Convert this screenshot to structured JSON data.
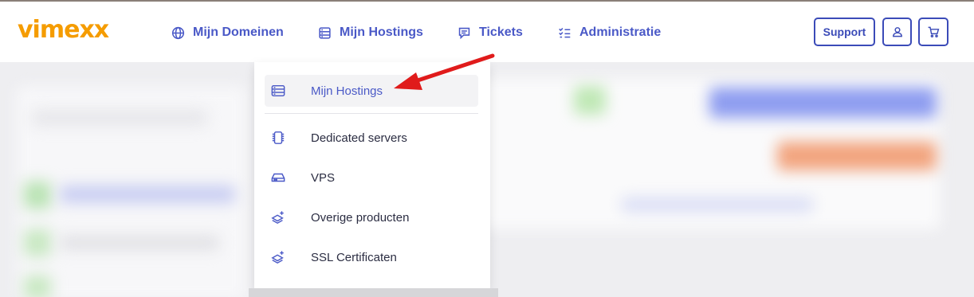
{
  "logo": "vimexx",
  "nav": [
    {
      "label": "Mijn Domeinen",
      "icon": "globe-icon"
    },
    {
      "label": "Mijn Hostings",
      "icon": "server-icon"
    },
    {
      "label": "Tickets",
      "icon": "chat-icon"
    },
    {
      "label": "Administratie",
      "icon": "checklist-icon"
    }
  ],
  "buttons": {
    "support": "Support",
    "account_icon": "user-icon",
    "cart_icon": "cart-icon"
  },
  "dropdown": [
    {
      "label": "Mijn Hostings",
      "icon": "server-icon"
    },
    {
      "label": "Dedicated servers",
      "icon": "chip-icon"
    },
    {
      "label": "VPS",
      "icon": "drive-icon"
    },
    {
      "label": "Overige producten",
      "icon": "layers-plus-icon"
    },
    {
      "label": "SSL Certificaten",
      "icon": "layers-plus-icon"
    }
  ],
  "colors": {
    "brand": "#f59c00",
    "accent": "#4a59c7",
    "annotation": "#e01b1b"
  }
}
